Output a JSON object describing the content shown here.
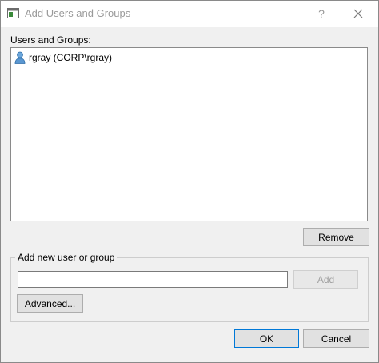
{
  "window": {
    "title": "Add Users and Groups",
    "help_symbol": "?"
  },
  "users_section": {
    "label": "Users and Groups:",
    "items": [
      {
        "name": "rgray (CORP\\rgray)",
        "icon": "user-icon"
      }
    ]
  },
  "buttons": {
    "remove": "Remove",
    "add": "Add",
    "advanced": "Advanced...",
    "ok": "OK",
    "cancel": "Cancel"
  },
  "add_group": {
    "legend": "Add new user or group",
    "input_value": ""
  },
  "icons": {
    "app": "window-icon",
    "help": "help-icon",
    "close": "close-icon",
    "user": "user-icon"
  }
}
